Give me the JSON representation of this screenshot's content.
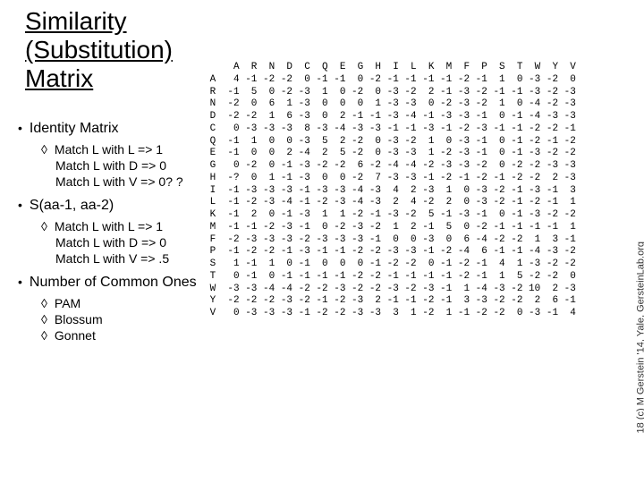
{
  "title": {
    "line1": "Similarity",
    "line2": "(Substitution)",
    "line3": "Matrix"
  },
  "bullets": {
    "b1": {
      "label": "Identity Matrix",
      "sub": {
        "s1": "Match L with L => 1",
        "s2": "Match L with D => 0",
        "s3": "Match L with V => 0? ?"
      }
    },
    "b2": {
      "label": "S(aa-1, aa-2)",
      "sub": {
        "s1": "Match L with L => 1",
        "s2": "Match L with D => 0",
        "s3": "Match L with V => .5"
      }
    },
    "b3": {
      "label": "Number of Common Ones",
      "sub": {
        "s1": "PAM",
        "s2": "Blossum",
        "s3": "Gonnet"
      }
    }
  },
  "matrix": {
    "cols": [
      "A",
      "R",
      "N",
      "D",
      "C",
      "Q",
      "E",
      "G",
      "H",
      "I",
      "L",
      "K",
      "M",
      "F",
      "P",
      "S",
      "T",
      "W",
      "Y",
      "V"
    ],
    "rows": [
      {
        "l": "A",
        "v": [
          4,
          -1,
          -2,
          -2,
          0,
          -1,
          -1,
          0,
          -2,
          -1,
          -1,
          -1,
          -1,
          -2,
          -1,
          1,
          0,
          -3,
          -2,
          0
        ]
      },
      {
        "l": "R",
        "v": [
          -1,
          5,
          0,
          -2,
          -3,
          1,
          0,
          -2,
          0,
          -3,
          -2,
          2,
          -1,
          -3,
          -2,
          -1,
          -1,
          -3,
          -2,
          -3
        ]
      },
      {
        "l": "N",
        "v": [
          -2,
          0,
          6,
          1,
          -3,
          0,
          0,
          0,
          1,
          -3,
          -3,
          0,
          -2,
          -3,
          -2,
          1,
          0,
          -4,
          -2,
          -3
        ]
      },
      {
        "l": "D",
        "v": [
          -2,
          -2,
          1,
          6,
          -3,
          0,
          2,
          -1,
          -1,
          -3,
          -4,
          -1,
          -3,
          -3,
          -1,
          0,
          -1,
          -4,
          -3,
          -3
        ]
      },
      {
        "l": "C",
        "v": [
          0,
          -3,
          -3,
          -3,
          8,
          -3,
          -4,
          -3,
          -3,
          -1,
          -1,
          -3,
          -1,
          -2,
          -3,
          -1,
          -1,
          -2,
          -2,
          -1
        ]
      },
      {
        "l": "Q",
        "v": [
          -1,
          1,
          0,
          0,
          -3,
          5,
          2,
          -2,
          0,
          -3,
          -2,
          1,
          0,
          -3,
          -1,
          0,
          -1,
          -2,
          -1,
          -2
        ]
      },
      {
        "l": "E",
        "v": [
          -1,
          0,
          0,
          2,
          -4,
          2,
          5,
          -2,
          0,
          -3,
          -3,
          1,
          -2,
          -3,
          -1,
          0,
          -1,
          -3,
          -2,
          -2
        ]
      },
      {
        "l": "G",
        "v": [
          0,
          -2,
          0,
          -1,
          -3,
          -2,
          -2,
          6,
          -2,
          -4,
          -4,
          -2,
          -3,
          -3,
          -2,
          0,
          -2,
          -2,
          -3,
          -3
        ]
      },
      {
        "l": "H",
        "v": [
          "-?",
          0,
          1,
          -1,
          -3,
          0,
          0,
          -2,
          7,
          -3,
          -3,
          -1,
          -2,
          -1,
          -2,
          -1,
          -2,
          -2,
          2,
          -3
        ]
      },
      {
        "l": "I",
        "v": [
          -1,
          -3,
          -3,
          -3,
          -1,
          -3,
          -3,
          -4,
          -3,
          4,
          2,
          -3,
          1,
          0,
          -3,
          -2,
          -1,
          -3,
          -1,
          3
        ]
      },
      {
        "l": "L",
        "v": [
          -1,
          -2,
          -3,
          -4,
          -1,
          -2,
          -3,
          -4,
          -3,
          2,
          4,
          -2,
          2,
          0,
          -3,
          -2,
          -1,
          -2,
          -1,
          1
        ]
      },
      {
        "l": "K",
        "v": [
          -1,
          2,
          0,
          -1,
          -3,
          1,
          1,
          -2,
          -1,
          -3,
          -2,
          5,
          -1,
          -3,
          -1,
          0,
          -1,
          -3,
          -2,
          -2
        ]
      },
      {
        "l": "M",
        "v": [
          -1,
          -1,
          -2,
          -3,
          -1,
          0,
          -2,
          -3,
          -2,
          1,
          2,
          -1,
          5,
          0,
          -2,
          -1,
          -1,
          -1,
          -1,
          1
        ]
      },
      {
        "l": "F",
        "v": [
          -2,
          -3,
          -3,
          -3,
          -2,
          -3,
          -3,
          -3,
          -1,
          0,
          0,
          -3,
          0,
          6,
          -4,
          -2,
          -2,
          1,
          3,
          -1
        ]
      },
      {
        "l": "P",
        "v": [
          -1,
          -2,
          -2,
          -1,
          -3,
          -1,
          -1,
          -2,
          -2,
          -3,
          -3,
          -1,
          -2,
          -4,
          6,
          -1,
          -1,
          -4,
          -3,
          -2
        ]
      },
      {
        "l": "S",
        "v": [
          1,
          -1,
          1,
          0,
          -1,
          0,
          0,
          0,
          -1,
          -2,
          -2,
          0,
          -1,
          -2,
          -1,
          4,
          1,
          -3,
          -2,
          -2
        ]
      },
      {
        "l": "T",
        "v": [
          0,
          -1,
          0,
          -1,
          -1,
          -1,
          -1,
          -2,
          -2,
          -1,
          -1,
          -1,
          -1,
          -2,
          -1,
          1,
          5,
          -2,
          -2,
          0
        ]
      },
      {
        "l": "W",
        "v": [
          -3,
          -3,
          -4,
          -4,
          -2,
          -2,
          -3,
          -2,
          -2,
          -3,
          -2,
          -3,
          -1,
          1,
          -4,
          -3,
          -2,
          10,
          2,
          -3
        ]
      },
      {
        "l": "Y",
        "v": [
          -2,
          -2,
          -2,
          -3,
          -2,
          -1,
          -2,
          -3,
          2,
          -1,
          -1,
          -2,
          -1,
          3,
          -3,
          -2,
          -2,
          2,
          6,
          -1
        ]
      },
      {
        "l": "V",
        "v": [
          0,
          -3,
          -3,
          -3,
          -1,
          -2,
          -2,
          -3,
          -3,
          3,
          1,
          -2,
          1,
          -1,
          -2,
          -2,
          0,
          -3,
          -1,
          4
        ]
      }
    ]
  },
  "credit": "18  (c) M Gerstein '14, Yale, GersteinLab.org",
  "chart_data": {
    "type": "table",
    "title": "Similarity (Substitution) Matrix",
    "columns": [
      "A",
      "R",
      "N",
      "D",
      "C",
      "Q",
      "E",
      "G",
      "H",
      "I",
      "L",
      "K",
      "M",
      "F",
      "P",
      "S",
      "T",
      "W",
      "Y",
      "V"
    ],
    "rows": [
      "A",
      "R",
      "N",
      "D",
      "C",
      "Q",
      "E",
      "G",
      "H",
      "I",
      "L",
      "K",
      "M",
      "F",
      "P",
      "S",
      "T",
      "W",
      "Y",
      "V"
    ],
    "values": [
      [
        4,
        -1,
        -2,
        -2,
        0,
        -1,
        -1,
        0,
        -2,
        -1,
        -1,
        -1,
        -1,
        -2,
        -1,
        1,
        0,
        -3,
        -2,
        0
      ],
      [
        -1,
        5,
        0,
        -2,
        -3,
        1,
        0,
        -2,
        0,
        -3,
        -2,
        2,
        -1,
        -3,
        -2,
        -1,
        -1,
        -3,
        -2,
        -3
      ],
      [
        -2,
        0,
        6,
        1,
        -3,
        0,
        0,
        0,
        1,
        -3,
        -3,
        0,
        -2,
        -3,
        -2,
        1,
        0,
        -4,
        -2,
        -3
      ],
      [
        -2,
        -2,
        1,
        6,
        -3,
        0,
        2,
        -1,
        -1,
        -3,
        -4,
        -1,
        -3,
        -3,
        -1,
        0,
        -1,
        -4,
        -3,
        -3
      ],
      [
        0,
        -3,
        -3,
        -3,
        8,
        -3,
        -4,
        -3,
        -3,
        -1,
        -1,
        -3,
        -1,
        -2,
        -3,
        -1,
        -1,
        -2,
        -2,
        -1
      ],
      [
        -1,
        1,
        0,
        0,
        -3,
        5,
        2,
        -2,
        0,
        -3,
        -2,
        1,
        0,
        -3,
        -1,
        0,
        -1,
        -2,
        -1,
        -2
      ],
      [
        -1,
        0,
        0,
        2,
        -4,
        2,
        5,
        -2,
        0,
        -3,
        -3,
        1,
        -2,
        -3,
        -1,
        0,
        -1,
        -3,
        -2,
        -2
      ],
      [
        0,
        -2,
        0,
        -1,
        -3,
        -2,
        -2,
        6,
        -2,
        -4,
        -4,
        -2,
        -3,
        -3,
        -2,
        0,
        -2,
        -2,
        -3,
        -3
      ],
      [
        null,
        0,
        1,
        -1,
        -3,
        0,
        0,
        -2,
        7,
        -3,
        -3,
        -1,
        -2,
        -1,
        -2,
        -1,
        -2,
        -2,
        2,
        -3
      ],
      [
        -1,
        -3,
        -3,
        -3,
        -1,
        -3,
        -3,
        -4,
        -3,
        4,
        2,
        -3,
        1,
        0,
        -3,
        -2,
        -1,
        -3,
        -1,
        3
      ],
      [
        -1,
        -2,
        -3,
        -4,
        -1,
        -2,
        -3,
        -4,
        -3,
        2,
        4,
        -2,
        2,
        0,
        -3,
        -2,
        -1,
        -2,
        -1,
        1
      ],
      [
        -1,
        2,
        0,
        -1,
        -3,
        1,
        1,
        -2,
        -1,
        -3,
        -2,
        5,
        -1,
        -3,
        -1,
        0,
        -1,
        -3,
        -2,
        -2
      ],
      [
        -1,
        -1,
        -2,
        -3,
        -1,
        0,
        -2,
        -3,
        -2,
        1,
        2,
        -1,
        5,
        0,
        -2,
        -1,
        -1,
        -1,
        -1,
        1
      ],
      [
        -2,
        -3,
        -3,
        -3,
        -2,
        -3,
        -3,
        -3,
        -1,
        0,
        0,
        -3,
        0,
        6,
        -4,
        -2,
        -2,
        1,
        3,
        -1
      ],
      [
        -1,
        -2,
        -2,
        -1,
        -3,
        -1,
        -1,
        -2,
        -2,
        -3,
        -3,
        -1,
        -2,
        -4,
        6,
        -1,
        -1,
        -4,
        -3,
        -2
      ],
      [
        1,
        -1,
        1,
        0,
        -1,
        0,
        0,
        0,
        -1,
        -2,
        -2,
        0,
        -1,
        -2,
        -1,
        4,
        1,
        -3,
        -2,
        -2
      ],
      [
        0,
        -1,
        0,
        -1,
        -1,
        -1,
        -1,
        -2,
        -2,
        -1,
        -1,
        -1,
        -1,
        -2,
        -1,
        1,
        5,
        -2,
        -2,
        0
      ],
      [
        -3,
        -3,
        -4,
        -4,
        -2,
        -2,
        -3,
        -2,
        -2,
        -3,
        -2,
        -3,
        -1,
        1,
        -4,
        -3,
        -2,
        10,
        2,
        -3
      ],
      [
        -2,
        -2,
        -2,
        -3,
        -2,
        -1,
        -2,
        -3,
        2,
        -1,
        -1,
        -2,
        -1,
        3,
        -3,
        -2,
        -2,
        2,
        6,
        -1
      ],
      [
        0,
        -3,
        -3,
        -3,
        -1,
        -2,
        -2,
        -3,
        -3,
        3,
        1,
        -2,
        1,
        -1,
        -2,
        -2,
        0,
        -3,
        -1,
        4
      ]
    ]
  }
}
